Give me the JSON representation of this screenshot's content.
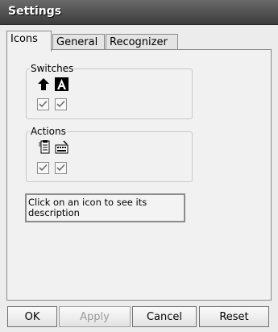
{
  "window": {
    "title": "Settings"
  },
  "tabs": [
    {
      "label": "Icons",
      "active": true
    },
    {
      "label": "General",
      "active": false
    },
    {
      "label": "Recognizer",
      "active": false
    }
  ],
  "switches": {
    "label": "Switches",
    "items": [
      {
        "icon": "shift-arrow-icon",
        "checked": true
      },
      {
        "icon": "caps-lock-icon",
        "checked": true
      }
    ]
  },
  "actions": {
    "label": "Actions",
    "items": [
      {
        "icon": "clipboard-icon",
        "checked": true
      },
      {
        "icon": "keyboard-icon",
        "checked": true
      }
    ]
  },
  "description": {
    "text": "Click on an icon to see its description"
  },
  "buttons": {
    "ok": "OK",
    "apply": "Apply",
    "cancel": "Cancel",
    "reset": "Reset"
  }
}
